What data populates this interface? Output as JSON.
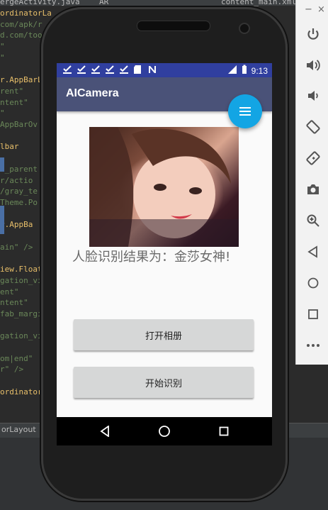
{
  "ide": {
    "tabs": [
      "ergeActivity.java",
      "AR",
      "content_main.xml"
    ],
    "code_lines": [
      {
        "text": "ordinatorLa",
        "cls": "code-tag"
      },
      {
        "text": "com/apk/r",
        "cls": "code-str"
      },
      {
        "text": "d.com/too",
        "cls": "code-str"
      },
      {
        "text": "\"",
        "cls": "code-str"
      },
      {
        "text": "\"",
        "cls": "code-str"
      },
      {
        "text": "",
        "cls": "code-plain"
      },
      {
        "text": "r.AppBarL",
        "cls": "code-tag"
      },
      {
        "text": "rent\"",
        "cls": "code-str"
      },
      {
        "text": "ntent\"",
        "cls": "code-str"
      },
      {
        "text": "\"",
        "cls": "code-str"
      },
      {
        "text": "AppBarOv",
        "cls": "code-str"
      },
      {
        "text": "",
        "cls": "code-plain"
      },
      {
        "text": "lbar",
        "cls": "code-tag"
      },
      {
        "text": "",
        "cls": "code-plain"
      },
      {
        "text": "h_parent",
        "cls": "code-str"
      },
      {
        "text": "r/actio",
        "cls": "code-str"
      },
      {
        "text": "/gray_te",
        "cls": "code-str"
      },
      {
        "text": "Theme.Po",
        "cls": "code-str"
      },
      {
        "text": "",
        "cls": "code-plain"
      },
      {
        "text": "r.AppBa",
        "cls": "code-tag"
      },
      {
        "text": "",
        "cls": "code-plain"
      },
      {
        "text": "ain\" />",
        "cls": "code-str"
      },
      {
        "text": "",
        "cls": "code-plain"
      },
      {
        "text": "iew.Float",
        "cls": "code-tag"
      },
      {
        "text": "gation_vi",
        "cls": "code-str"
      },
      {
        "text": "ent\"",
        "cls": "code-str"
      },
      {
        "text": "ntent\"",
        "cls": "code-str"
      },
      {
        "text": "fab_margi",
        "cls": "code-str"
      },
      {
        "text": "",
        "cls": "code-plain"
      },
      {
        "text": "gation_vi",
        "cls": "code-str"
      },
      {
        "text": "",
        "cls": "code-plain"
      },
      {
        "text": "om|end\"",
        "cls": "code-str"
      },
      {
        "text": "r\" />",
        "cls": "code-str"
      },
      {
        "text": "",
        "cls": "code-plain"
      },
      {
        "text": "ordinator",
        "cls": "code-tag"
      }
    ],
    "bottom_label": "orLayout"
  },
  "emulator_toolbar": {
    "top_controls": [
      "−",
      "×"
    ],
    "buttons": [
      {
        "name": "power-icon"
      },
      {
        "name": "volume-up-icon"
      },
      {
        "name": "volume-down-icon"
      },
      {
        "name": "rotate-left-icon"
      },
      {
        "name": "rotate-right-icon"
      },
      {
        "name": "camera-icon"
      },
      {
        "name": "zoom-icon"
      },
      {
        "name": "back-icon"
      },
      {
        "name": "home-icon"
      },
      {
        "name": "overview-icon"
      },
      {
        "name": "more-icon"
      }
    ]
  },
  "status_bar": {
    "time": "9:13",
    "network": "LTE",
    "color": "#303f9f"
  },
  "app": {
    "title": "AICamera",
    "fab_color": "#13a5e4",
    "appbar_color": "#4a5278",
    "result_text": "人脸识别结果为：金莎女神!",
    "open_album_label": "打开相册",
    "start_recognition_label": "开始识别"
  }
}
